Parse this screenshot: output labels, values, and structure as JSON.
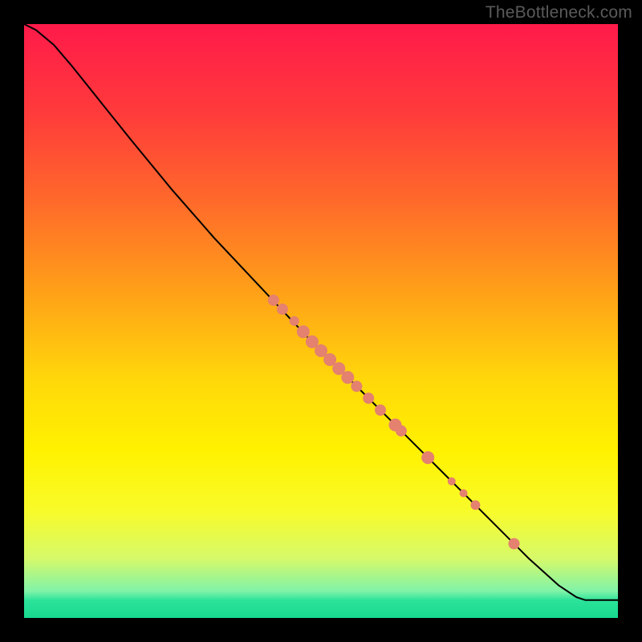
{
  "watermark": "TheBottleneck.com",
  "chart_data": {
    "type": "line",
    "title": "",
    "xlabel": "",
    "ylabel": "",
    "xlim": [
      0,
      100
    ],
    "ylim": [
      0,
      100
    ],
    "grid": false,
    "legend": false,
    "background_gradient": [
      {
        "offset": 0.0,
        "color": "#ff1a4a"
      },
      {
        "offset": 0.15,
        "color": "#ff3b3b"
      },
      {
        "offset": 0.3,
        "color": "#ff6a2a"
      },
      {
        "offset": 0.45,
        "color": "#ffa018"
      },
      {
        "offset": 0.6,
        "color": "#ffd80a"
      },
      {
        "offset": 0.72,
        "color": "#fff200"
      },
      {
        "offset": 0.82,
        "color": "#f8fb2a"
      },
      {
        "offset": 0.9,
        "color": "#d6f96a"
      },
      {
        "offset": 0.955,
        "color": "#80f3a8"
      },
      {
        "offset": 0.97,
        "color": "#2de39a"
      },
      {
        "offset": 1.0,
        "color": "#17d98f"
      }
    ],
    "curve": [
      {
        "x": 0.0,
        "y": 100.0
      },
      {
        "x": 2.0,
        "y": 99.0
      },
      {
        "x": 5.0,
        "y": 96.5
      },
      {
        "x": 8.0,
        "y": 93.0
      },
      {
        "x": 12.0,
        "y": 88.0
      },
      {
        "x": 18.0,
        "y": 80.5
      },
      {
        "x": 25.0,
        "y": 72.0
      },
      {
        "x": 32.0,
        "y": 64.0
      },
      {
        "x": 40.0,
        "y": 55.5
      },
      {
        "x": 48.0,
        "y": 47.0
      },
      {
        "x": 55.0,
        "y": 40.0
      },
      {
        "x": 62.0,
        "y": 33.0
      },
      {
        "x": 70.0,
        "y": 25.0
      },
      {
        "x": 78.0,
        "y": 17.0
      },
      {
        "x": 85.0,
        "y": 10.0
      },
      {
        "x": 90.0,
        "y": 5.5
      },
      {
        "x": 93.0,
        "y": 3.5
      },
      {
        "x": 94.5,
        "y": 3.0
      },
      {
        "x": 100.0,
        "y": 3.0
      }
    ],
    "points": [
      {
        "x": 42.0,
        "y": 53.5,
        "r": 7
      },
      {
        "x": 43.5,
        "y": 52.0,
        "r": 7
      },
      {
        "x": 45.5,
        "y": 50.0,
        "r": 6
      },
      {
        "x": 47.0,
        "y": 48.2,
        "r": 8
      },
      {
        "x": 48.5,
        "y": 46.5,
        "r": 8
      },
      {
        "x": 50.0,
        "y": 45.0,
        "r": 8
      },
      {
        "x": 51.5,
        "y": 43.5,
        "r": 8
      },
      {
        "x": 53.0,
        "y": 42.0,
        "r": 8
      },
      {
        "x": 54.5,
        "y": 40.5,
        "r": 8
      },
      {
        "x": 56.0,
        "y": 39.0,
        "r": 7
      },
      {
        "x": 58.0,
        "y": 37.0,
        "r": 7
      },
      {
        "x": 60.0,
        "y": 35.0,
        "r": 7
      },
      {
        "x": 62.5,
        "y": 32.5,
        "r": 8
      },
      {
        "x": 63.5,
        "y": 31.5,
        "r": 7
      },
      {
        "x": 68.0,
        "y": 27.0,
        "r": 8
      },
      {
        "x": 72.0,
        "y": 23.0,
        "r": 5
      },
      {
        "x": 74.0,
        "y": 21.0,
        "r": 5
      },
      {
        "x": 76.0,
        "y": 19.0,
        "r": 6
      },
      {
        "x": 82.5,
        "y": 12.5,
        "r": 7
      }
    ],
    "point_color": "#e4816f",
    "curve_color": "#000000"
  }
}
